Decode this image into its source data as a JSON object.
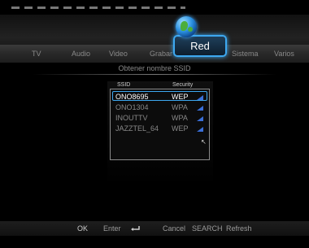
{
  "menu": {
    "items": [
      {
        "label": "TV"
      },
      {
        "label": "Audio"
      },
      {
        "label": "Video"
      },
      {
        "label": "Grabar"
      },
      {
        "label": "Red",
        "selected": true
      },
      {
        "label": "Sistema"
      },
      {
        "label": "Varios"
      }
    ]
  },
  "subtitle": "Obtener nombre SSID",
  "list": {
    "headers": {
      "ssid": "SSID",
      "security": "Security"
    },
    "rows": [
      {
        "ssid": "ONO8695",
        "security": "WEP",
        "selected": true
      },
      {
        "ssid": "ONO1304",
        "security": "WPA"
      },
      {
        "ssid": "INOUTTV",
        "security": "WPA"
      },
      {
        "ssid": "JAZZTEL_64",
        "security": "WEP"
      }
    ]
  },
  "footer": {
    "ok": "OK",
    "enter": "Enter",
    "cancel": "Cancel",
    "search": "SEARCH",
    "refresh": "Refresh"
  },
  "colors": {
    "accent": "#3da8f0",
    "background": "#000000",
    "text": "#8a8a8a"
  },
  "icons": {
    "network": "globe-icon",
    "signal": "signal-strength-icon",
    "enter": "return-arrow-icon"
  }
}
